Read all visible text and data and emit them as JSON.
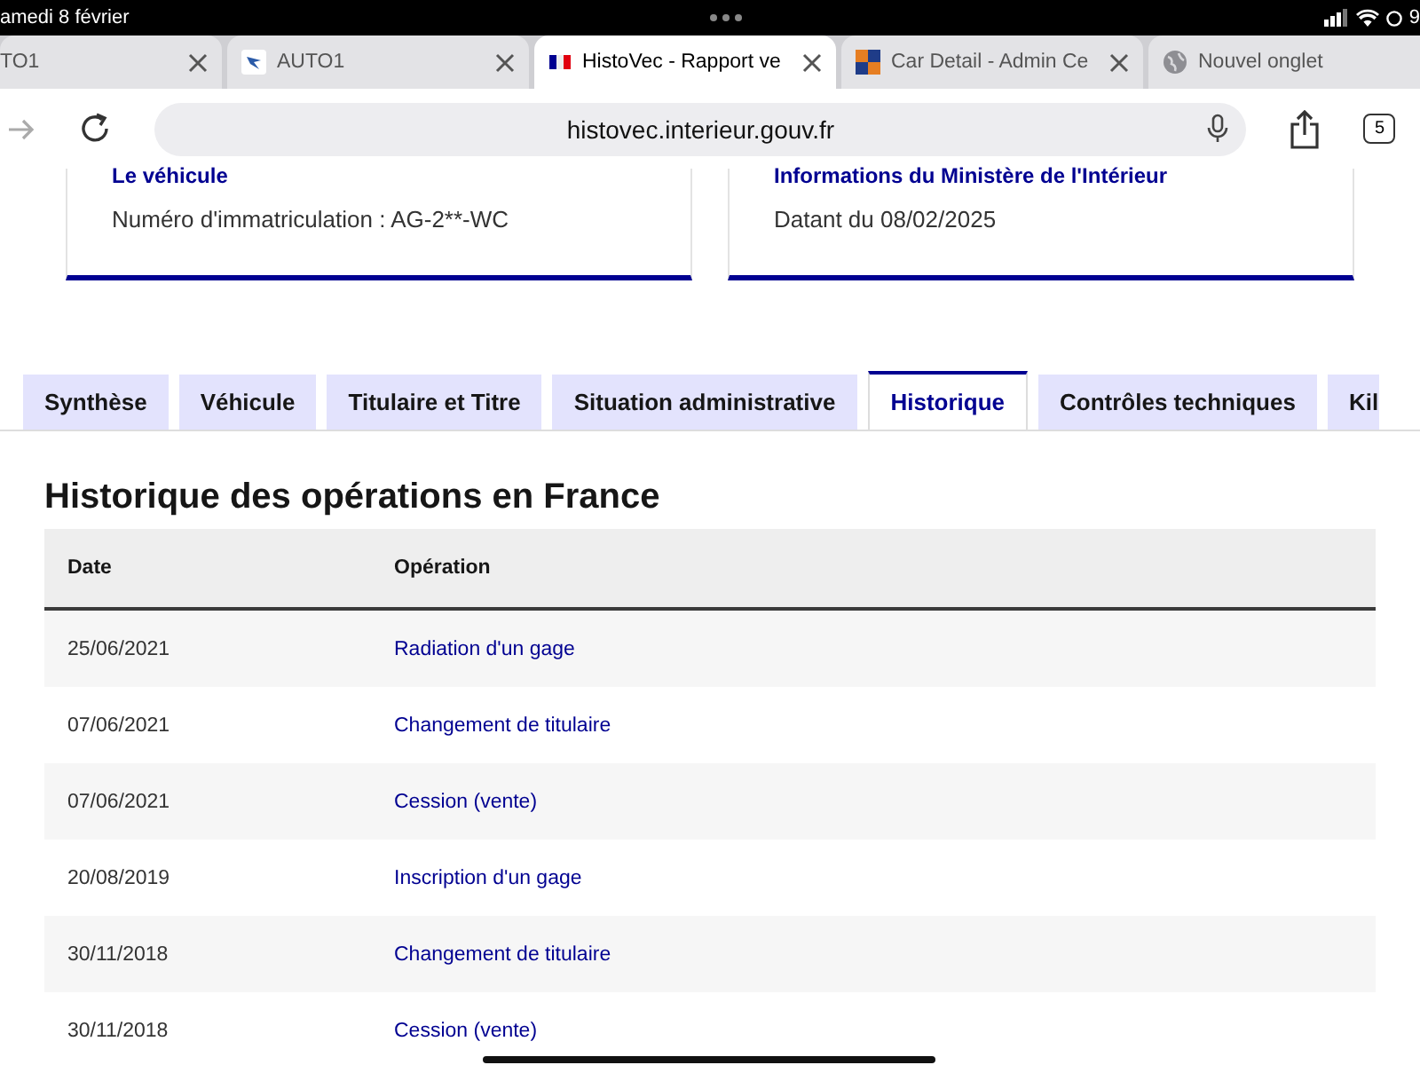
{
  "status_bar": {
    "date": "amedi 8 février",
    "battery": "9"
  },
  "browser_tabs": [
    {
      "title": "TO1",
      "selected": false
    },
    {
      "title": "AUTO1",
      "selected": false
    },
    {
      "title": "HistoVec - Rapport ve",
      "selected": true
    },
    {
      "title": "Car Detail - Admin Ce",
      "selected": false
    },
    {
      "title": "Nouvel onglet",
      "selected": false
    }
  ],
  "address_bar": {
    "url": "histovec.interieur.gouv.fr",
    "tab_count": "5"
  },
  "cards": [
    {
      "title": "Le véhicule",
      "text": "Numéro d'immatriculation : AG-2**-WC"
    },
    {
      "title": "Informations du Ministère de l'Intérieur",
      "text": "Datant du 08/02/2025"
    }
  ],
  "tabs": [
    {
      "label": "Synthèse",
      "selected": false
    },
    {
      "label": "Véhicule",
      "selected": false
    },
    {
      "label": "Titulaire et Titre",
      "selected": false
    },
    {
      "label": "Situation administrative",
      "selected": false
    },
    {
      "label": "Historique",
      "selected": true
    },
    {
      "label": "Contrôles techniques",
      "selected": false
    },
    {
      "label": "Kil",
      "selected": false
    }
  ],
  "section_title": "Historique des opérations en France",
  "table": {
    "columns": [
      "Date",
      "Opération"
    ],
    "rows": [
      [
        "25/06/2021",
        "Radiation d'un gage"
      ],
      [
        "07/06/2021",
        "Changement de titulaire"
      ],
      [
        "07/06/2021",
        "Cession (vente)"
      ],
      [
        "20/08/2019",
        "Inscription d'un gage"
      ],
      [
        "30/11/2018",
        "Changement de titulaire"
      ],
      [
        "30/11/2018",
        "Cession (vente)"
      ]
    ]
  }
}
